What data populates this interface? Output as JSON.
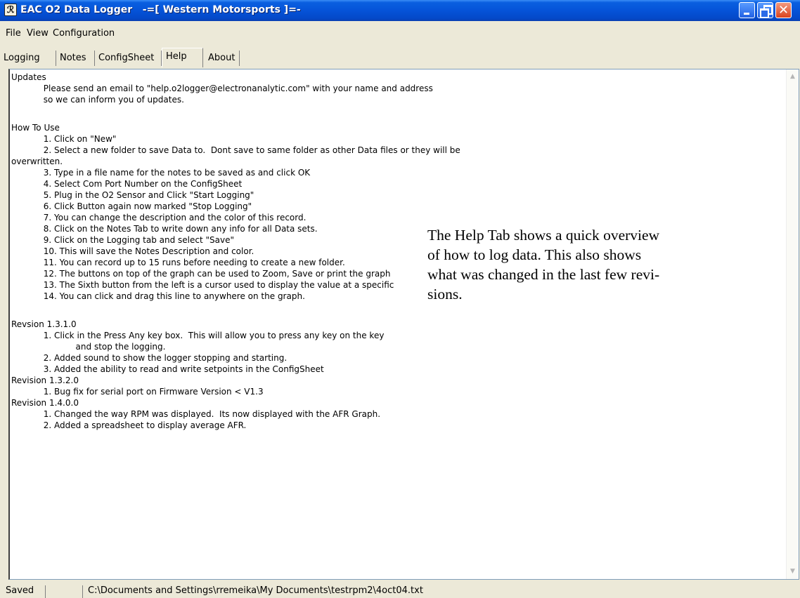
{
  "window": {
    "title": "EAC O2 Data Logger   -=[ Western Motorsports ]=-",
    "icon_name": "app-logo-icon"
  },
  "menu": [
    "File",
    "View",
    "Configuration"
  ],
  "tabs": [
    {
      "label": "Logging",
      "active": false
    },
    {
      "label": "Notes",
      "active": false
    },
    {
      "label": "ConfigSheet",
      "active": false
    },
    {
      "label": "Help",
      "active": true
    },
    {
      "label": "About",
      "active": false
    }
  ],
  "help_text": [
    "Updates",
    "            Please send an email to \"help.o2logger@electronanalytic.com\" with your name and address",
    "            so we can inform you of updates.",
    "",
    "How To Use",
    "            1. Click on \"New\"",
    "            2. Select a new folder to save Data to.  Dont save to same folder as other Data files or they will be",
    "overwritten.",
    "            3. Type in a file name for the notes to be saved as and click OK",
    "            4. Select Com Port Number on the ConfigSheet",
    "            5. Plug in the O2 Sensor and Click \"Start Logging\"",
    "            6. Click Button again now marked \"Stop Logging\"",
    "            7. You can change the description and the color of this record.",
    "            8. Click on the Notes Tab to write down any info for all Data sets.",
    "            9. Click on the Logging tab and select \"Save\"",
    "            10. This will save the Notes Description and color.",
    "            11. You can record up to 15 runs before needing to create a new folder.",
    "            12. The buttons on top of the graph can be used to Zoom, Save or print the graph",
    "            13. The Sixth button from the left is a cursor used to display the value at a specific",
    "            14. You can click and drag this line to anywhere on the graph.",
    "",
    "Revsion 1.3.1.0",
    "            1. Click in the Press Any key box.  This will allow you to press any key on the key",
    "                        and stop the logging.",
    "            2. Added sound to show the logger stopping and starting.",
    "            3. Added the ability to read and write setpoints in the ConfigSheet",
    "Revision 1.3.2.0",
    "            1. Bug fix for serial port on Firmware Version < V1.3",
    "Revision 1.4.0.0",
    "            1. Changed the way RPM was displayed.  Its now displayed with the AFR Graph.",
    "            2. Added a spreadsheet to display average AFR."
  ],
  "overlay_lines": [
    "The Help Tab shows a quick overview",
    "of how to log data.  This also shows",
    "what was changed in the last few revi-",
    "sions."
  ],
  "status": {
    "state": "Saved",
    "empty": "",
    "path": "C:\\Documents and Settings\\rremeika\\My Documents\\testrpm2\\4oct04.txt"
  }
}
